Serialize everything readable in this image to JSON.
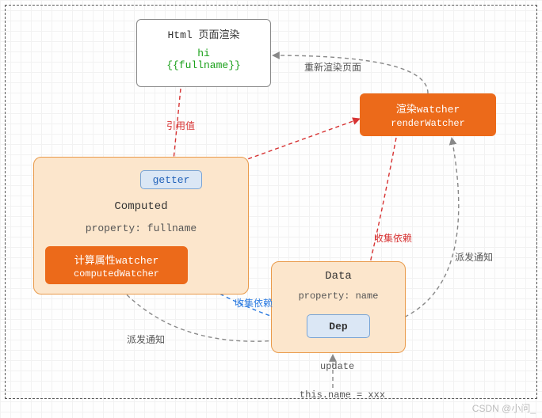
{
  "htmlBox": {
    "title": "Html 页面渲染",
    "line1": "hi",
    "line2": "{{fullname}}"
  },
  "renderWatcher": {
    "title": "渲染watcher",
    "sub": "renderWatcher"
  },
  "computed": {
    "getter": "getter",
    "title": "Computed",
    "property": "property: fullname",
    "watcherTitle": "计算属性watcher",
    "watcherSub": "computedWatcher"
  },
  "dataBox": {
    "title": "Data",
    "property": "property: name",
    "dep": "Dep"
  },
  "labels": {
    "rerender": "重新渲染页面",
    "refValue": "引用值",
    "collectDepsRed": "收集依赖",
    "collectDepsBlue": "收集依赖",
    "dispatch1": "派发通知",
    "dispatch2": "派发通知",
    "update": "update",
    "assignment": "this.name = xxx"
  },
  "watermark": "CSDN @小问_",
  "colors": {
    "red": "#d73333",
    "blue": "#2b7ae0",
    "gray": "#888888"
  }
}
